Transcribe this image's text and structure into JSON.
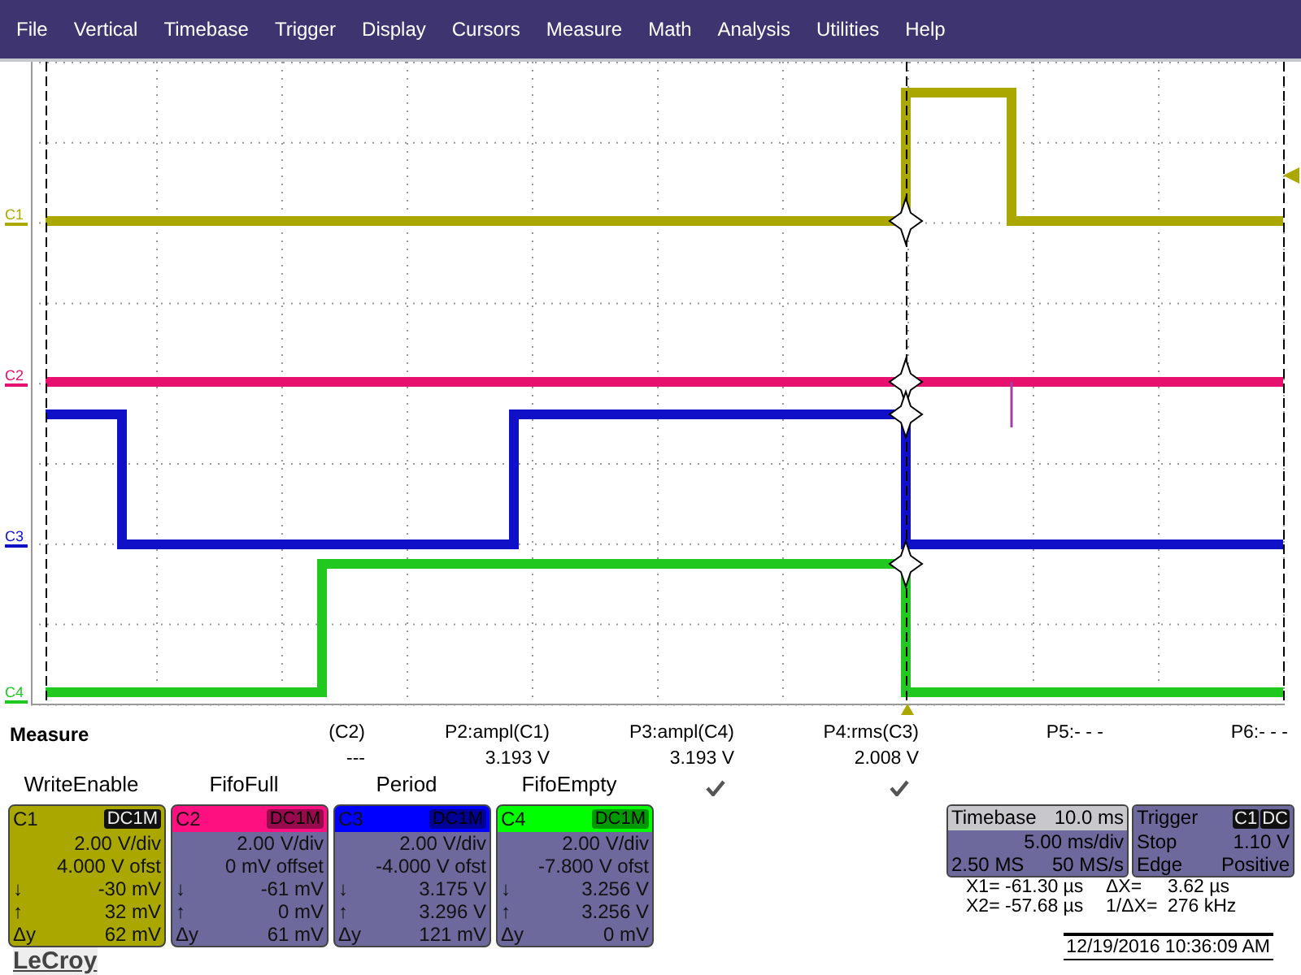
{
  "menu": [
    "File",
    "Vertical",
    "Timebase",
    "Trigger",
    "Display",
    "Cursors",
    "Measure",
    "Math",
    "Analysis",
    "Utilities",
    "Help"
  ],
  "plot": {
    "markers": [
      {
        "label": "C1",
        "color": "#aaa800"
      },
      {
        "label": "C2",
        "color": "#e8106e"
      },
      {
        "label": "C3",
        "color": "#1010c8"
      },
      {
        "label": "C4",
        "color": "#20c820"
      }
    ]
  },
  "measure": {
    "title": "Measure",
    "params": [
      {
        "name": "(C2)",
        "value": "---",
        "checked": false
      },
      {
        "name": "P2:ampl(C1)",
        "value": "3.193 V",
        "checked": false
      },
      {
        "name": "P3:ampl(C4)",
        "value": "3.193 V",
        "checked": true
      },
      {
        "name": "P4:rms(C3)",
        "value": "2.008 V",
        "checked": true
      },
      {
        "name": "P5:- - -",
        "checked": false
      },
      {
        "name": "P6:- - -",
        "checked": false
      }
    ]
  },
  "channels": [
    {
      "label": "WriteEnable",
      "name": "C1",
      "coupling": "DC1M",
      "color": "#aaa800",
      "selected": true,
      "scale": "2.00 V/div",
      "offset": "4.000 V ofst",
      "readings": [
        {
          "label": "↓",
          "value": "-30 mV"
        },
        {
          "label": "↑",
          "value": "32 mV"
        },
        {
          "label": "Δy",
          "value": "62 mV"
        }
      ]
    },
    {
      "label": "FifoFull",
      "name": "C2",
      "coupling": "DC1M",
      "color": "#ff1080",
      "selected": false,
      "scale": "2.00 V/div",
      "offset": "0 mV offset",
      "readings": [
        {
          "label": "↓",
          "value": "-61 mV"
        },
        {
          "label": "↑",
          "value": "0 mV"
        },
        {
          "label": "Δy",
          "value": "61 mV"
        }
      ]
    },
    {
      "label": "Period",
      "name": "C3",
      "coupling": "DC1M",
      "color": "#0000ff",
      "selected": false,
      "scale": "2.00 V/div",
      "offset": "-4.000 V ofst",
      "readings": [
        {
          "label": "↓",
          "value": "3.175 V"
        },
        {
          "label": "↑",
          "value": "3.296 V"
        },
        {
          "label": "Δy",
          "value": "121 mV"
        }
      ]
    },
    {
      "label": "FifoEmpty",
      "name": "C4",
      "coupling": "DC1M",
      "color": "#00ff00",
      "selected": false,
      "scale": "2.00 V/div",
      "offset": "-7.800 V ofst",
      "readings": [
        {
          "label": "↓",
          "value": "3.256 V"
        },
        {
          "label": "↑",
          "value": "3.256 V"
        },
        {
          "label": "Δy",
          "value": "0 mV"
        }
      ]
    }
  ],
  "timebase": {
    "title": "Timebase",
    "total": "10.0 ms",
    "per_div": "5.00 ms/div",
    "samples": "2.50 MS",
    "rate": "50 MS/s"
  },
  "trigger": {
    "title": "Trigger",
    "source": "C1",
    "coupling": "DC",
    "mode": "Stop",
    "level": "1.10 V",
    "type": "Edge",
    "slope": "Positive"
  },
  "cursors": [
    {
      "label": "X1=",
      "value": "-61.30 µs",
      "delta_label": "ΔX=",
      "delta_value": "3.62 µs"
    },
    {
      "label": "X2=",
      "value": "-57.68 µs",
      "delta_label": "1/ΔX=",
      "delta_value": "276 kHz"
    }
  ],
  "logo": "LeCroy",
  "datetime": "12/19/2016 10:36:09 AM"
}
